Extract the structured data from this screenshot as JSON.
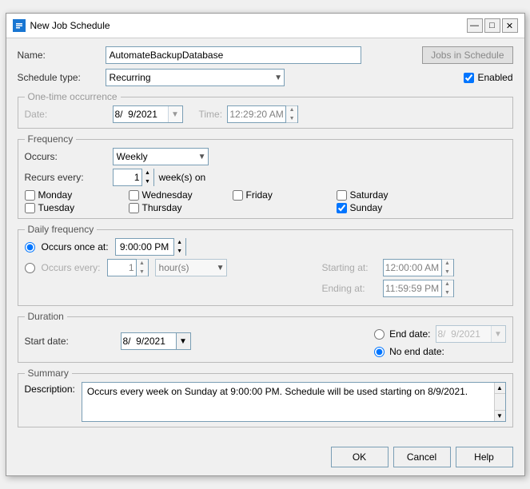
{
  "titlebar": {
    "title": "New Job Schedule",
    "min_label": "—",
    "max_label": "□",
    "close_label": "✕"
  },
  "form": {
    "name_label": "Name:",
    "name_value": "AutomateBackupDatabase",
    "jobs_in_schedule_label": "Jobs in Schedule",
    "schedule_type_label": "Schedule type:",
    "schedule_type_value": "Recurring",
    "enabled_label": "Enabled",
    "one_time_label": "One-time occurrence",
    "date_label": "Date:",
    "date_value": "8/  9/2021",
    "time_label": "Time:",
    "time_value": "12:29:20 AM"
  },
  "frequency": {
    "section_label": "Frequency",
    "occurs_label": "Occurs:",
    "occurs_value": "Weekly",
    "recurs_every_label": "Recurs every:",
    "recurs_every_value": "1",
    "recurs_unit": "week(s) on",
    "days": [
      {
        "label": "Monday",
        "checked": false
      },
      {
        "label": "Wednesday",
        "checked": false
      },
      {
        "label": "Friday",
        "checked": false
      },
      {
        "label": "Saturday",
        "checked": false
      },
      {
        "label": "Tuesday",
        "checked": false
      },
      {
        "label": "Thursday",
        "checked": false
      },
      {
        "label": "Sunday",
        "checked": true
      }
    ]
  },
  "daily_frequency": {
    "section_label": "Daily frequency",
    "once_at_label": "Occurs once at:",
    "once_at_value": "9:00:00 PM",
    "every_label": "Occurs every:",
    "every_value": "1",
    "every_unit_value": "hour(s)",
    "starting_at_label": "Starting at:",
    "starting_at_value": "12:00:00 AM",
    "ending_at_label": "Ending at:",
    "ending_at_value": "11:59:59 PM"
  },
  "duration": {
    "section_label": "Duration",
    "start_date_label": "Start date:",
    "start_date_value": "8/  9/2021",
    "end_date_label": "End date:",
    "end_date_value": "8/  9/2021",
    "no_end_date_label": "No end date:"
  },
  "summary": {
    "section_label": "Summary",
    "description_label": "Description:",
    "description_value": "Occurs every week on Sunday at 9:00:00 PM. Schedule will be used starting on 8/9/2021."
  },
  "footer": {
    "ok_label": "OK",
    "cancel_label": "Cancel",
    "help_label": "Help"
  }
}
